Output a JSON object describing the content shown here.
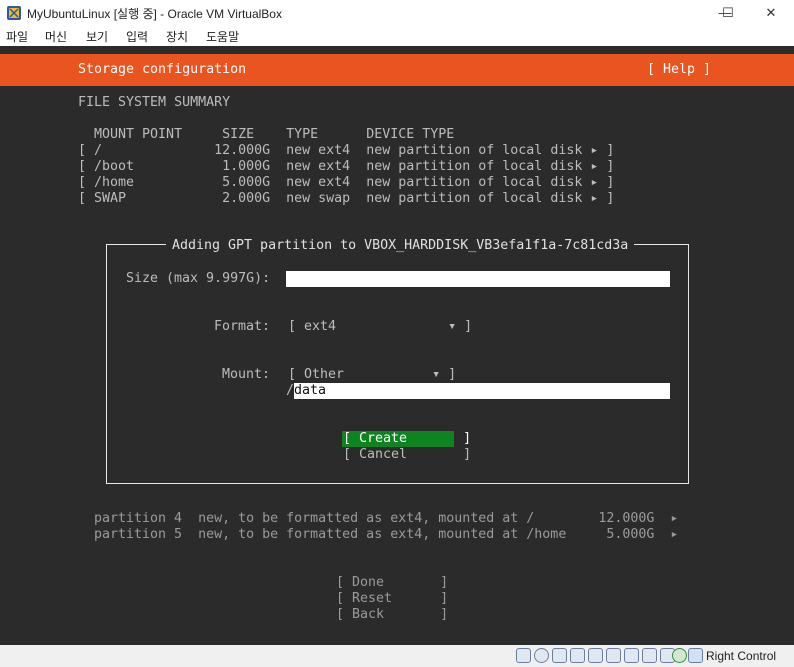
{
  "window": {
    "title": "MyUbuntuLinux [실행 중] - Oracle VM VirtualBox",
    "minimize": "—",
    "maximize": "☐",
    "close": "✕"
  },
  "menu": [
    "파일",
    "머신",
    "보기",
    "입력",
    "장치",
    "도움말"
  ],
  "header": {
    "title": "Storage configuration",
    "help": "[ Help ]"
  },
  "summary": {
    "heading": "FILE SYSTEM SUMMARY",
    "columns": "  MOUNT POINT     SIZE    TYPE      DEVICE TYPE",
    "rows": [
      "[ /              12.000G  new ext4  new partition of local disk ▸ ]",
      "[ /boot           1.000G  new ext4  new partition of local disk ▸ ]",
      "[ /home           5.000G  new ext4  new partition of local disk ▸ ]",
      "[ SWAP            2.000G  new swap  new partition of local disk ▸ ]"
    ]
  },
  "dialog": {
    "title": "Adding GPT partition to VBOX_HARDDISK_VB3efa1f1a-7c81cd3a",
    "size_label": "Size (max 9.997G):",
    "size_value": "",
    "format_label": "Format:",
    "format_value": "[ ext4              ▾ ]",
    "mount_label": "Mount:",
    "mount_value": "[ Other           ▾ ]",
    "mount_prefix": "/",
    "mount_path": "data",
    "create_label": "[ Create       ]",
    "cancel_label": "[ Cancel       ]"
  },
  "partitions": [
    "partition 4  new, to be formatted as ext4, mounted at /        12.000G  ▸",
    "partition 5  new, to be formatted as ext4, mounted at /home     5.000G  ▸"
  ],
  "footer": {
    "done": "[ Done       ]",
    "reset": "[ Reset      ]",
    "back": "[ Back       ]"
  },
  "statusbar": {
    "host_key": "Right Control",
    "icons": [
      "hdd-icon",
      "optical-icon",
      "audio-icon",
      "network-icon",
      "usb-icon",
      "shared-folder-icon",
      "display-icon",
      "recording-icon",
      "cpu-icon",
      "mouse-integration-icon",
      "keyboard-icon"
    ]
  },
  "colors": {
    "accent": "#e95420",
    "terminal_bg": "#2b2b2b",
    "active_button": "#0e8420"
  }
}
